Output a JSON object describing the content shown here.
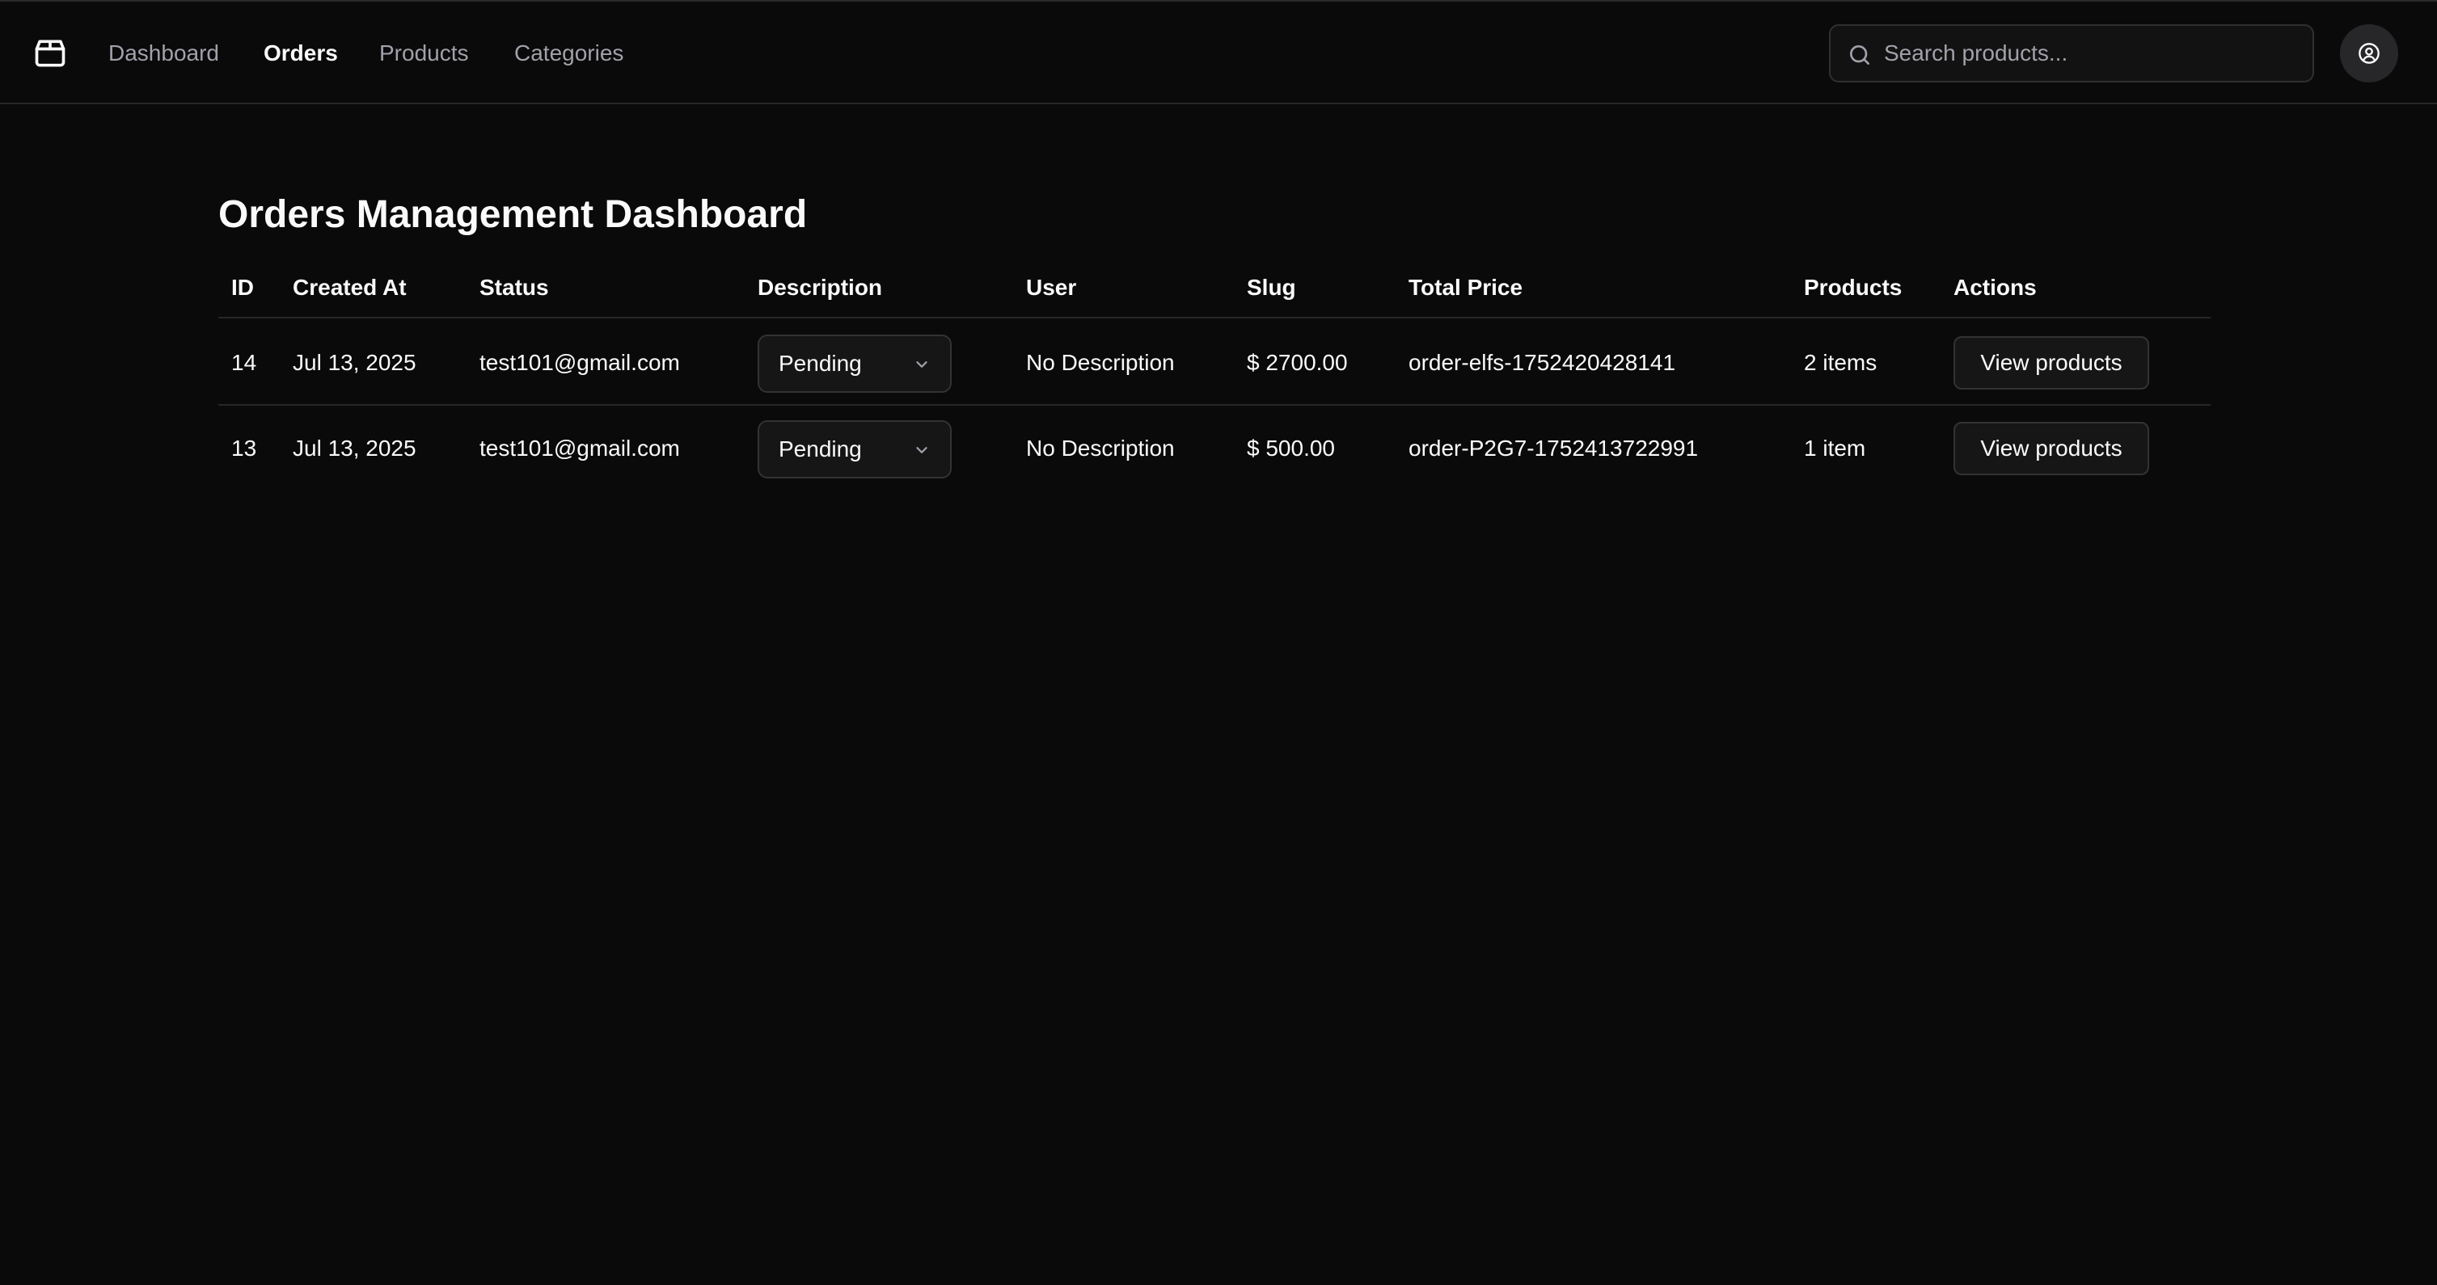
{
  "nav": {
    "logo_icon": "package-icon",
    "items": [
      {
        "label": "Dashboard",
        "active": false
      },
      {
        "label": "Orders",
        "active": true
      },
      {
        "label": "Products",
        "active": false
      },
      {
        "label": "Categories",
        "active": false
      }
    ]
  },
  "search": {
    "placeholder": "Search products...",
    "value": "",
    "icon": "search-icon"
  },
  "user": {
    "icon": "user-circle-icon"
  },
  "page": {
    "title": "Orders Management Dashboard"
  },
  "table": {
    "columns": [
      "ID",
      "Created At",
      "Status",
      "Description",
      "User",
      "Slug",
      "Total Price",
      "Products",
      "Actions"
    ],
    "rows": [
      {
        "id": "14",
        "created_at": "Jul 13, 2025",
        "email": "test101@gmail.com",
        "status": "Pending",
        "description": "No Description",
        "price": "$ 2700.00",
        "slug": "order-elfs-1752420428141",
        "products": "2 items",
        "action": "View products"
      },
      {
        "id": "13",
        "created_at": "Jul 13, 2025",
        "email": "test101@gmail.com",
        "status": "Pending",
        "description": "No Description",
        "price": "$ 500.00",
        "slug": "order-P2G7-1752413722991",
        "products": "1 item",
        "action": "View products"
      }
    ]
  },
  "colors": {
    "background": "#0a0a0a",
    "text": "#fafafa",
    "muted": "#a1a1aa",
    "border": "#262626"
  }
}
